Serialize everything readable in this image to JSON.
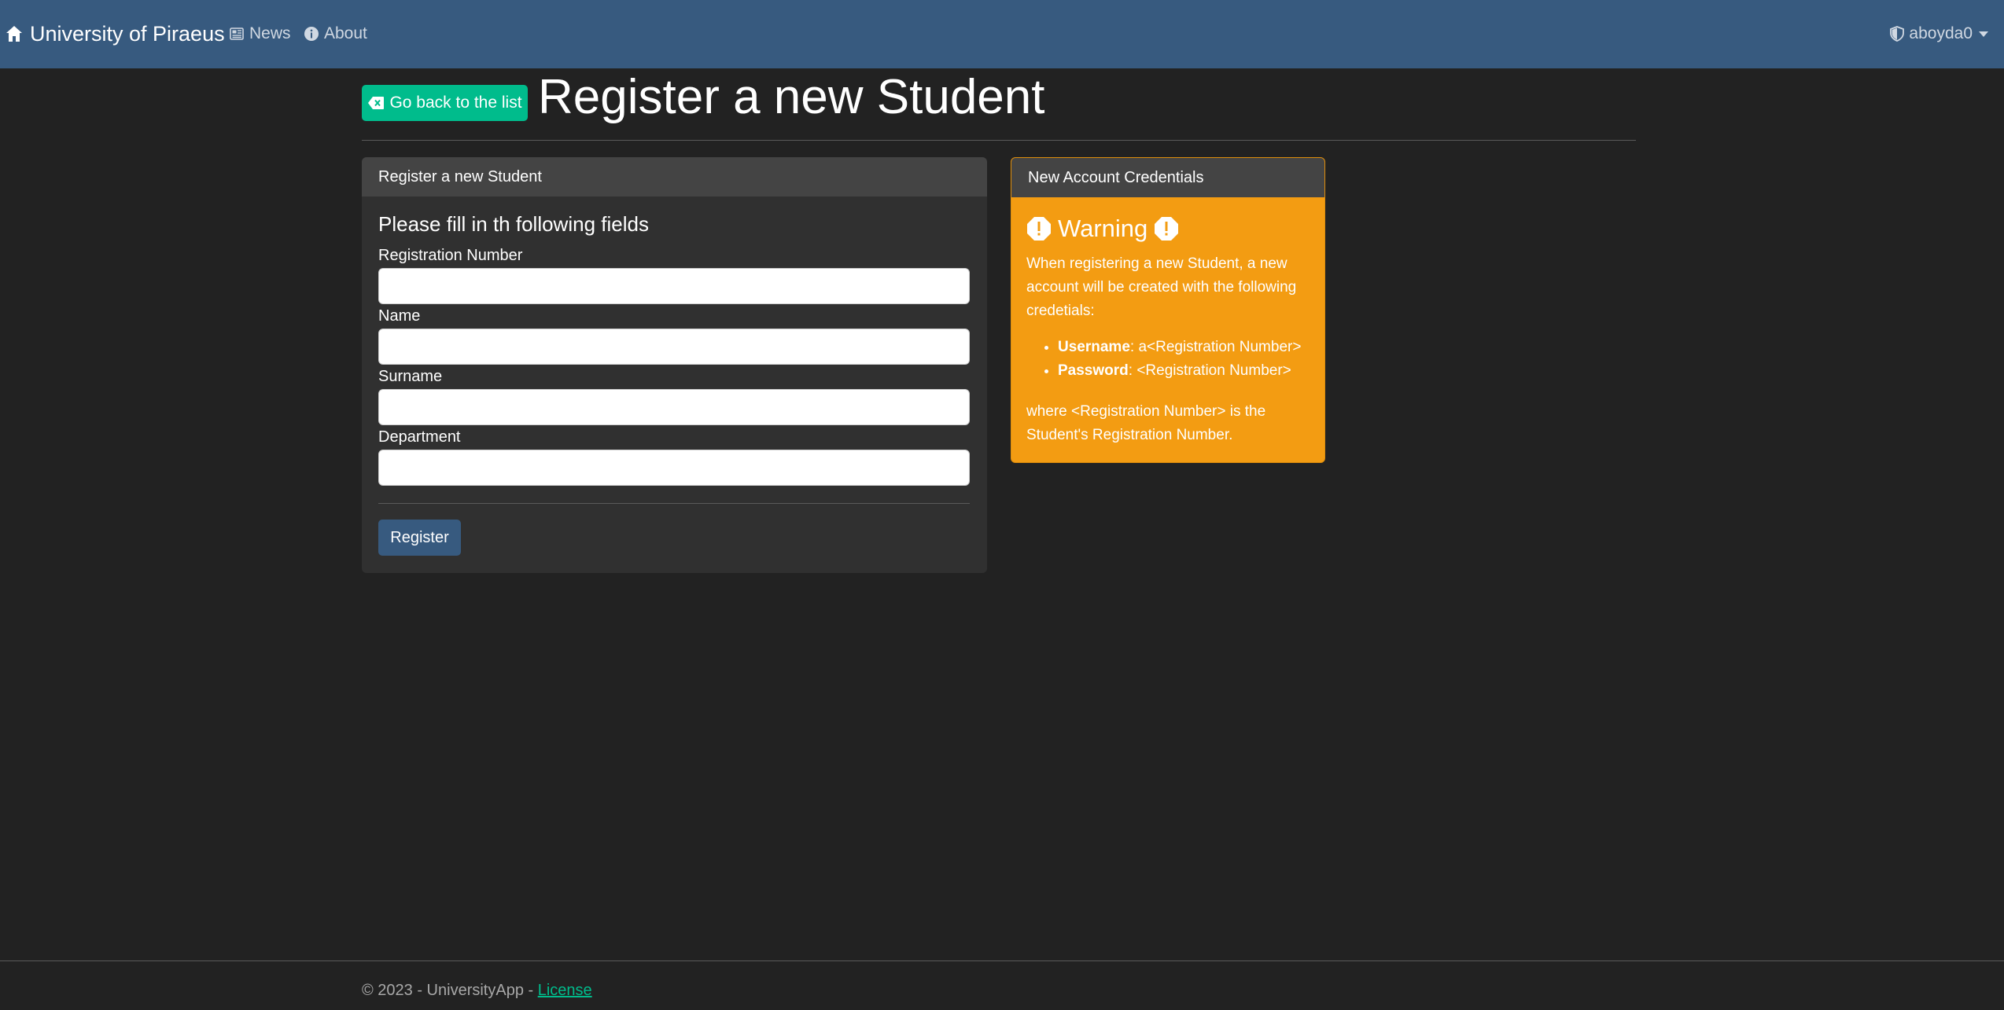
{
  "navbar": {
    "brand": "University of Piraeus",
    "links": [
      {
        "label": "News",
        "icon": "newspaper-icon"
      },
      {
        "label": "About",
        "icon": "info-icon"
      }
    ],
    "user": {
      "name": "aboyda0",
      "icon": "shield-icon"
    }
  },
  "header": {
    "back_button": "Go back to the list",
    "title": "Register a new Student"
  },
  "form_card": {
    "header": "Register a new Student",
    "heading": "Please fill in th following fields",
    "fields": [
      {
        "label": "Registration Number",
        "value": ""
      },
      {
        "label": "Name",
        "value": ""
      },
      {
        "label": "Surname",
        "value": ""
      },
      {
        "label": "Department",
        "value": ""
      }
    ],
    "submit_label": "Register"
  },
  "warning_card": {
    "header": "New Account Credentials",
    "title": "Warning",
    "intro": "When registering a new Student, a new account will be created with the following credetials:",
    "credentials": [
      {
        "key": "Username",
        "value": ": a<Registration Number>"
      },
      {
        "key": "Password",
        "value": ": <Registration Number>"
      }
    ],
    "outro": "where <Registration Number> is the Student's Registration Number."
  },
  "footer": {
    "text": "© 2023 - UniversityApp - ",
    "link": "License"
  },
  "colors": {
    "navbar": "#375a7f",
    "background": "#222222",
    "success": "#00bc8c",
    "warning": "#f39c12",
    "card": "#303030",
    "card_header": "#444444"
  }
}
